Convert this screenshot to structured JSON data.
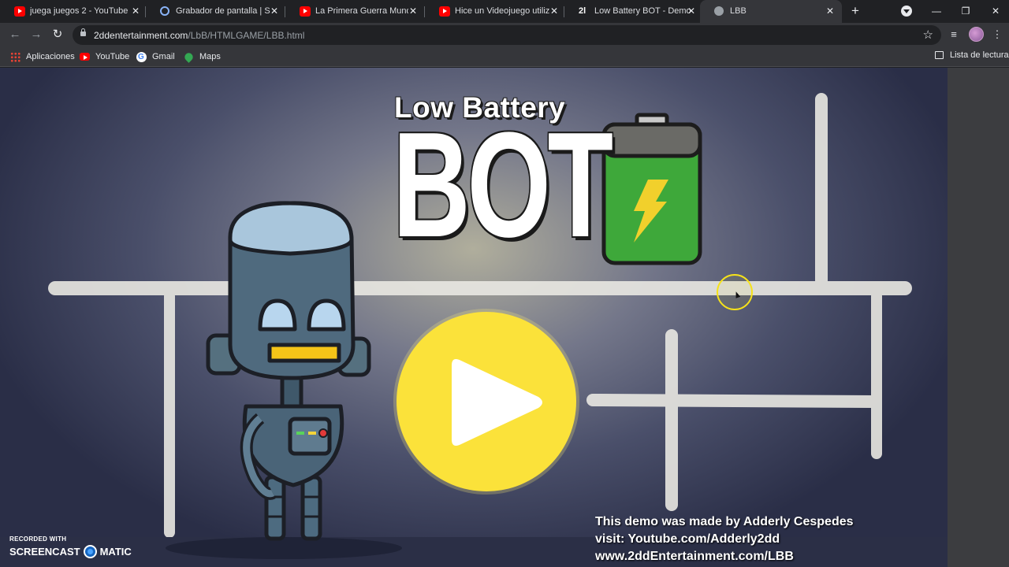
{
  "tabs": [
    {
      "title": "juega juegos 2 - YouTube",
      "icon": "youtube-icon"
    },
    {
      "title": "Grabador de pantalla | Screencast-O-Matic",
      "icon": "screencast-icon"
    },
    {
      "title": "La Primera Guerra Mundial",
      "icon": "youtube-icon"
    },
    {
      "title": "Hice un Videojuego utilizando",
      "icon": "youtube-icon"
    },
    {
      "title": "Low Battery BOT - Demo Game",
      "icon": "2dd-icon"
    },
    {
      "title": "LBB",
      "icon": "lbb-icon",
      "active": true
    }
  ],
  "toolbar": {
    "url_domain": "2ddentertainment.com",
    "url_path": "/LbB/HTMLGAME/LBB.html"
  },
  "bookmarks": {
    "items": [
      {
        "label": "Aplicaciones",
        "icon": "apps-grid-icon"
      },
      {
        "label": "YouTube",
        "icon": "youtube-icon"
      },
      {
        "label": "Gmail",
        "icon": "google-icon"
      },
      {
        "label": "Maps",
        "icon": "maps-icon"
      }
    ],
    "reading_list": "Lista de lectura"
  },
  "game": {
    "logo_top": "Low Battery",
    "logo_main": "BOT",
    "credits": [
      "This demo was made by Adderly Cespedes",
      "visit: Youtube.com/Adderly2dd",
      "www.2ddEntertainment.com/LBB"
    ]
  },
  "watermark": {
    "line1": "RECORDED WITH",
    "brand_left": "SCREENCAST",
    "brand_right": "MATIC"
  },
  "colors": {
    "play_button": "#fbe23a",
    "battery_green": "#3ea83a",
    "browser_dark": "#202124"
  }
}
